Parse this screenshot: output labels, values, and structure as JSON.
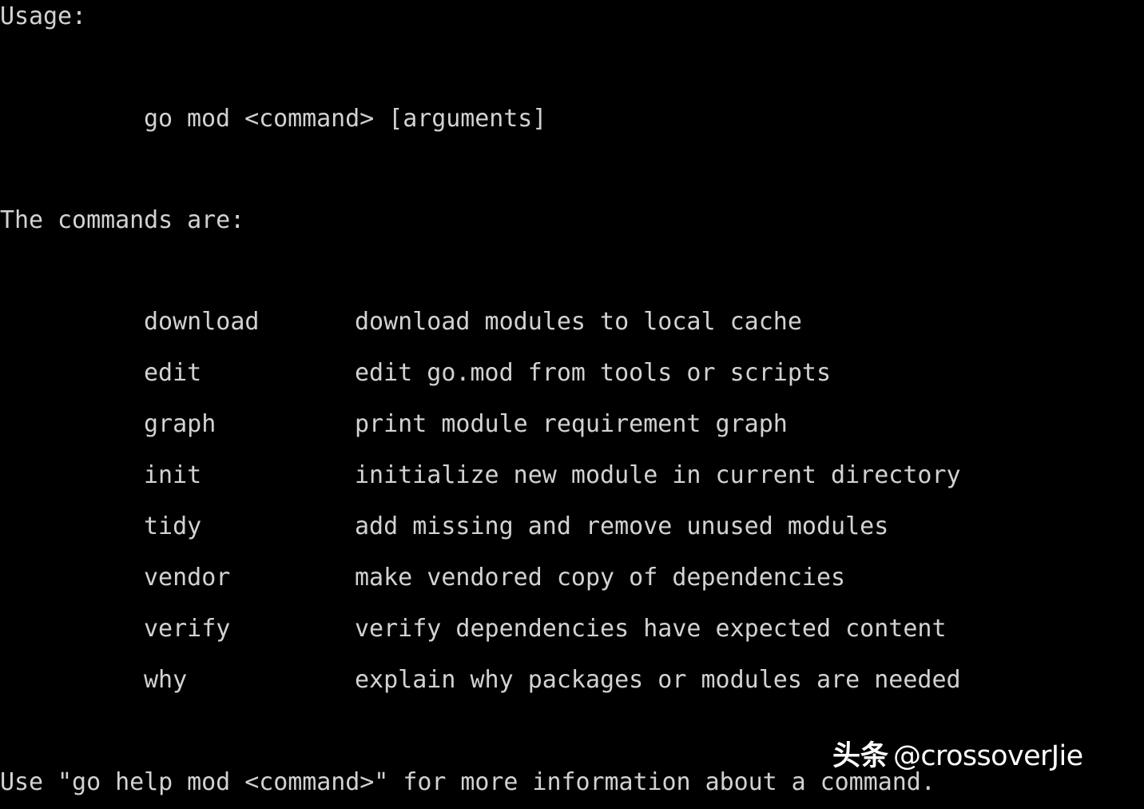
{
  "terminal": {
    "background_color": "#000000",
    "text_color": "#d2d2d2",
    "usage_label": "Usage:",
    "synopsis": "go mod <command> [arguments]",
    "commands_heading": "The commands are:",
    "commands": [
      {
        "name": "download",
        "description": "download modules to local cache"
      },
      {
        "name": "edit",
        "description": "edit go.mod from tools or scripts"
      },
      {
        "name": "graph",
        "description": "print module requirement graph"
      },
      {
        "name": "init",
        "description": "initialize new module in current directory"
      },
      {
        "name": "tidy",
        "description": "add missing and remove unused modules"
      },
      {
        "name": "vendor",
        "description": "make vendored copy of dependencies"
      },
      {
        "name": "verify",
        "description": "verify dependencies have expected content"
      },
      {
        "name": "why",
        "description": "explain why packages or modules are needed"
      }
    ],
    "footer": "Use \"go help mod <command>\" for more information about a command."
  },
  "watermark": {
    "logo_text": "头条",
    "handle_text": "@crossoverJie",
    "color": "#ffffff"
  }
}
